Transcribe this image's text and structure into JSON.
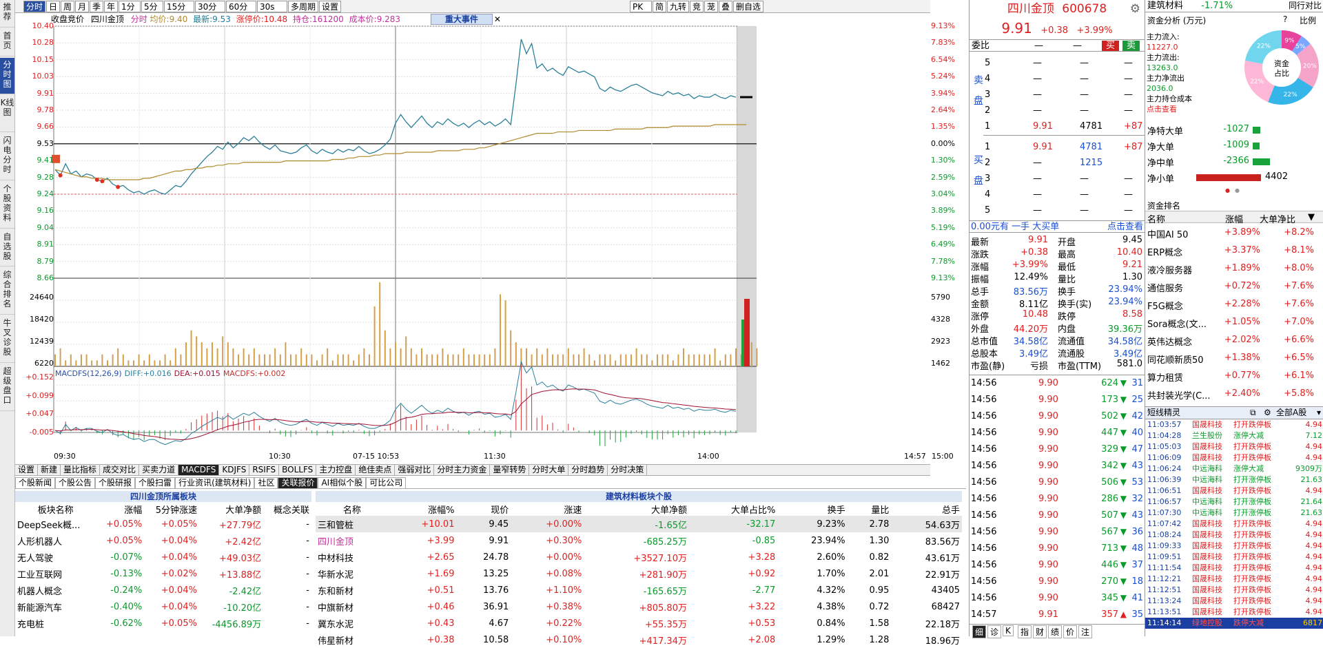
{
  "leftnav": [
    "推荐",
    "首页",
    "分时图",
    "K线图",
    "闪电分时",
    "个股资料",
    "自选股",
    "综合排名",
    "牛叉诊股",
    "超级盘口"
  ],
  "toolbar": {
    "buttons": [
      "分时",
      "日",
      "周",
      "月",
      "季",
      "年",
      "1分",
      "5分",
      "15分",
      "30分",
      "60分",
      "30s",
      "多周期",
      "设置"
    ],
    "right": [
      "PK",
      "简",
      "九转",
      "竞",
      "茏",
      "叠",
      "删自选"
    ]
  },
  "infobar": {
    "mode": "收盘竞价",
    "name": "四川金顶",
    "fenshi": "分时",
    "avg_label": "均价:",
    "avg": "9.40",
    "latest_label": "最新:",
    "latest": "9.53",
    "limit_label": "涨停价:",
    "limit": "10.48",
    "hold_label": "持仓:",
    "hold": "161200",
    "cost_label": "成本价:",
    "cost": "9.283",
    "event": "重大事件"
  },
  "chart_data": {
    "type": "line",
    "title": "",
    "price_axis_left": [
      "10.40",
      "10.28",
      "10.15",
      "10.03",
      "9.91",
      "9.78",
      "9.66",
      "9.53",
      "9.41",
      "9.28",
      "9.24",
      "9.16",
      "9.04",
      "8.91",
      "8.79",
      "8.66"
    ],
    "price_axis_right": [
      "9.13%",
      "7.83%",
      "6.54%",
      "5.24%",
      "3.94%",
      "2.64%",
      "1.35%",
      "0.00%",
      "1.30%",
      "2.59%",
      "3.04%",
      "3.89%",
      "5.19%",
      "6.49%",
      "7.78%",
      "9.13%"
    ],
    "volume_axis_left": [
      "24640",
      "18420",
      "12439",
      "6220"
    ],
    "volume_axis_right": [
      "5790",
      "4328",
      "2923",
      "1462"
    ],
    "macd_axis": [
      "+0.152",
      "+0.099",
      "+0.047",
      "-0.005"
    ],
    "macd_label": "MACDFS(12,26,9)",
    "diff_label": "DIFF:",
    "diff": "+0.016",
    "dea_label": "DEA:",
    "dea": "+0.015",
    "macdfs_label": "MACDFS:",
    "macdfs": "+0.002",
    "time_axis": [
      "09:30",
      "10:30",
      "07-15 10:53",
      "11:30",
      "14:00",
      "14:57",
      "15:00"
    ],
    "prev_close": 9.53,
    "ylim": [
      8.66,
      10.4
    ],
    "price": [
      9.41,
      9.37,
      9.45,
      9.38,
      9.4,
      9.36,
      9.38,
      9.37,
      9.34,
      9.33,
      9.35,
      9.31,
      9.29,
      9.3,
      9.27,
      9.25,
      9.26,
      9.24,
      9.26,
      9.27,
      9.25,
      9.24,
      9.27,
      9.3,
      9.29,
      9.33,
      9.38,
      9.42,
      9.46,
      9.5,
      9.53,
      9.57,
      9.55,
      9.6,
      9.56,
      9.59,
      9.63,
      9.61,
      9.64,
      9.6,
      9.57,
      9.55,
      9.58,
      9.54,
      9.53,
      9.52,
      9.53,
      9.56,
      9.58,
      9.54,
      9.52,
      9.55,
      9.53,
      9.52,
      9.55,
      9.53,
      9.55,
      9.54,
      9.57,
      9.54,
      9.52,
      9.53,
      9.55,
      9.58,
      9.62,
      9.73,
      9.79,
      9.74,
      9.7,
      9.74,
      9.78,
      9.73,
      9.7,
      9.74,
      9.72,
      9.76,
      9.73,
      9.71,
      9.73,
      9.7,
      9.73,
      9.75,
      9.72,
      9.74,
      9.71,
      9.73,
      9.76,
      9.72,
      10.0,
      10.31,
      10.21,
      10.28,
      10.11,
      10.14,
      10.09,
      10.11,
      10.08,
      10.06,
      10.12,
      10.1,
      10.08,
      10.09,
      10.07,
      10.05,
      9.97,
      9.95,
      9.98,
      9.96,
      9.95,
      9.97,
      9.99,
      10.0,
      9.98,
      9.96,
      9.94,
      9.93,
      9.92,
      9.95,
      9.93,
      9.94,
      9.92,
      9.93,
      9.9,
      9.92,
      9.91,
      9.91,
      9.93,
      9.91,
      9.9,
      9.92,
      9.91
    ],
    "avg": [
      9.41,
      9.4,
      9.39,
      9.38,
      9.37,
      9.36,
      9.36,
      9.35,
      9.35,
      9.35,
      9.34,
      9.34,
      9.34,
      9.34,
      9.34,
      9.34,
      9.34,
      9.35,
      9.35,
      9.36,
      9.37,
      9.38,
      9.39,
      9.4,
      9.4,
      9.41,
      9.41,
      9.42,
      9.42,
      9.43,
      9.43,
      9.44,
      9.44,
      9.45,
      9.45,
      9.45,
      9.46,
      9.46,
      9.46,
      9.46,
      9.46,
      9.46,
      9.46,
      9.46,
      9.47,
      9.47,
      9.47,
      9.47,
      9.47,
      9.47,
      9.47,
      9.47,
      9.47,
      9.48,
      9.48,
      9.48,
      9.49,
      9.49,
      9.5,
      9.5,
      9.5,
      9.51,
      9.51,
      9.52,
      9.52,
      9.52,
      9.52,
      9.53,
      9.53,
      9.53,
      9.53,
      9.53,
      9.53,
      9.54,
      9.54,
      9.54,
      9.54,
      9.54,
      9.55,
      9.55,
      9.55,
      9.56,
      9.56,
      9.57,
      9.58,
      9.59,
      9.6,
      9.61,
      9.62,
      9.63,
      9.64,
      9.65,
      9.66,
      9.66,
      9.66,
      9.66,
      9.67,
      9.67,
      9.67,
      9.67,
      9.68,
      9.68,
      9.68,
      9.68,
      9.68,
      9.68,
      9.68,
      9.69,
      9.69,
      9.69,
      9.69,
      9.69,
      9.69,
      9.7,
      9.7,
      9.7,
      9.7,
      9.7,
      9.71,
      9.71,
      9.71,
      9.71,
      9.71,
      9.71,
      9.71,
      9.71,
      9.72,
      9.72,
      9.72,
      9.72,
      9.72,
      9.72,
      9.72
    ],
    "volume": [
      2,
      3,
      1,
      2,
      1,
      2,
      2,
      1,
      1,
      2,
      1,
      2,
      3,
      2,
      1,
      1,
      2,
      1,
      2,
      1,
      1,
      2,
      1,
      3,
      2,
      4,
      6,
      5,
      4,
      3,
      4,
      3,
      5,
      4,
      3,
      2,
      3,
      2,
      3,
      2,
      2,
      2,
      3,
      2,
      4,
      2,
      2,
      3,
      2,
      2,
      1,
      2,
      3,
      1,
      2,
      2,
      2,
      1,
      2,
      3,
      2,
      10,
      14,
      6,
      3,
      4,
      3,
      5,
      3,
      2,
      3,
      2,
      2,
      2,
      3,
      2,
      2,
      2,
      3,
      2,
      2,
      2,
      2,
      2,
      3,
      12,
      11,
      6,
      4,
      3,
      3,
      2,
      3,
      2,
      3,
      2,
      2,
      2,
      3,
      2,
      2,
      3,
      2,
      1,
      2,
      2,
      2,
      1,
      2,
      2,
      2,
      3,
      2,
      2,
      1,
      2,
      2,
      2,
      1,
      2,
      3,
      2,
      2,
      2,
      2,
      2,
      3,
      1,
      2,
      2,
      3,
      2,
      2,
      4,
      3
    ]
  },
  "bottom_tabs": [
    "设置",
    "新建",
    "量比指标",
    "成交对比",
    "买卖力道",
    "MACDFS",
    "KDJFS",
    "RSIFS",
    "BOLLFS",
    "主力控盘",
    "绝佳卖点",
    "强弱对比",
    "分时主力资金",
    "量窄转势",
    "分时大单",
    "分时趋势",
    "分时决策"
  ],
  "bottom_tabs2": [
    "个股新闻",
    "个股公告",
    "个股研报",
    "个股扫雷",
    "行业资讯(建筑材料)",
    "社区",
    "关联报价",
    "AI相似个股",
    "可比公司"
  ],
  "sector_table": {
    "title": "四川金顶所属板块",
    "headers": [
      "板块名称",
      "涨幅",
      "5分钟涨速",
      "大单净额",
      "概念关联"
    ],
    "rows": [
      [
        "DeepSeek概...",
        "+0.05%",
        "+0.05%",
        "+27.79亿",
        "-"
      ],
      [
        "人形机器人",
        "+0.05%",
        "+0.04%",
        "+2.42亿",
        "-"
      ],
      [
        "无人驾驶",
        "-0.07%",
        "+0.04%",
        "+49.03亿",
        "-"
      ],
      [
        "工业互联网",
        "-0.13%",
        "+0.02%",
        "+13.88亿",
        "-"
      ],
      [
        "机器人概念",
        "-0.24%",
        "+0.04%",
        "-2.42亿",
        "-"
      ],
      [
        "新能源汽车",
        "-0.40%",
        "+0.04%",
        "-10.20亿",
        "-"
      ],
      [
        "充电桩",
        "-0.62%",
        "+0.05%",
        "-4456.89万",
        "-"
      ]
    ]
  },
  "stock_table": {
    "title": "建筑材料板块个股",
    "headers": [
      "名称",
      "涨幅%",
      "现价",
      "涨速",
      "大单净额",
      "大单占比%",
      "换手",
      "量比",
      "总手"
    ],
    "rows": [
      [
        "三和管桩",
        "+10.01",
        "9.45",
        "+0.00%",
        "-1.65亿",
        "-32.17",
        "9.23%",
        "2.78",
        "54.63万"
      ],
      [
        "四川金顶",
        "+3.99",
        "9.91",
        "+0.30%",
        "-685.25万",
        "-0.85",
        "23.94%",
        "1.30",
        "83.56万"
      ],
      [
        "中材科技",
        "+2.65",
        "24.78",
        "+0.00%",
        "+3527.10万",
        "+3.28",
        "2.60%",
        "0.82",
        "43.61万"
      ],
      [
        "华新水泥",
        "+1.69",
        "13.25",
        "+0.08%",
        "+281.90万",
        "+0.92",
        "1.70%",
        "2.01",
        "22.91万"
      ],
      [
        "东和新材",
        "+0.51",
        "13.76",
        "+1.10%",
        "-165.65万",
        "-2.77",
        "4.32%",
        "0.95",
        "43405"
      ],
      [
        "中旗新材",
        "+0.46",
        "36.91",
        "+0.38%",
        "+805.80万",
        "+3.22",
        "4.38%",
        "0.72",
        "68427"
      ],
      [
        "冀东水泥",
        "+0.43",
        "4.67",
        "+0.22%",
        "+55.35万",
        "+0.53",
        "0.84%",
        "1.58",
        "22.18万"
      ],
      [
        "伟星新材",
        "+0.38",
        "10.58",
        "+0.10%",
        "+417.34万",
        "+2.08",
        "1.29%",
        "1.28",
        "18.96万"
      ]
    ]
  },
  "quote": {
    "name": "四川金顶",
    "code": "600678",
    "price": "9.91",
    "change": "+0.38",
    "pct": "+3.99%",
    "weibi": "委比",
    "buy": "买",
    "sell": "卖",
    "sell_label": "卖盘",
    "buy_label": "买盘",
    "asks": [
      [
        "5",
        "—",
        "—",
        "—"
      ],
      [
        "4",
        "—",
        "—",
        "—"
      ],
      [
        "3",
        "—",
        "—",
        "—"
      ],
      [
        "2",
        "—",
        "—",
        "—"
      ],
      [
        "1",
        "9.91",
        "4781",
        "+87"
      ]
    ],
    "bids": [
      [
        "1",
        "9.91",
        "4781",
        "+87"
      ],
      [
        "2",
        "—",
        "1215",
        ""
      ],
      [
        "3",
        "—",
        "—",
        "—"
      ],
      [
        "4",
        "—",
        "—",
        "—"
      ],
      [
        "5",
        "—",
        "—",
        "—"
      ]
    ],
    "dadan": {
      "a": "0.00元有",
      "b": "一手",
      "c": "大买单",
      "d": "点击查看"
    },
    "stats": [
      [
        "最新",
        "9.91",
        "开盘",
        "9.45"
      ],
      [
        "涨跌",
        "+0.38",
        "最高",
        "10.40"
      ],
      [
        "涨幅",
        "+3.99%",
        "最低",
        "9.21"
      ],
      [
        "振幅",
        "12.49%",
        "量比",
        "1.30"
      ],
      [
        "总手",
        "83.56万",
        "换手",
        "23.94%"
      ],
      [
        "金额",
        "8.11亿",
        "换手(实)",
        "23.94%"
      ],
      [
        "涨停",
        "10.48",
        "跌停",
        "8.58"
      ],
      [
        "外盘",
        "44.20万",
        "内盘",
        "39.36万"
      ],
      [
        "总市值",
        "34.58亿",
        "流通值",
        "34.58亿"
      ],
      [
        "总股本",
        "3.49亿",
        "流通股",
        "3.49亿"
      ],
      [
        "市盈(静)",
        "亏损",
        "市盈(TTM)",
        "581.0"
      ]
    ],
    "ticks": [
      [
        "14:56",
        "9.90",
        "624",
        "31"
      ],
      [
        "14:56",
        "9.90",
        "173",
        "25"
      ],
      [
        "14:56",
        "9.90",
        "502",
        "42"
      ],
      [
        "14:56",
        "9.90",
        "447",
        "40"
      ],
      [
        "14:56",
        "9.90",
        "329",
        "47"
      ],
      [
        "14:56",
        "9.90",
        "342",
        "43"
      ],
      [
        "14:56",
        "9.90",
        "506",
        "53"
      ],
      [
        "14:56",
        "9.90",
        "286",
        "32"
      ],
      [
        "14:56",
        "9.90",
        "507",
        "43"
      ],
      [
        "14:56",
        "9.90",
        "567",
        "36"
      ],
      [
        "14:56",
        "9.90",
        "713",
        "48"
      ],
      [
        "14:56",
        "9.90",
        "446",
        "37"
      ],
      [
        "14:56",
        "9.90",
        "270",
        "18"
      ],
      [
        "14:56",
        "9.90",
        "345",
        "41"
      ],
      [
        "14:57",
        "9.91",
        "357",
        "35"
      ]
    ],
    "bottom": [
      "细",
      "诊",
      "K",
      "指",
      "财",
      "绩",
      "价",
      "注"
    ]
  },
  "right": {
    "sector": "建筑材料",
    "sector_pct": "-1.71%",
    "sector_tag": "同行对比",
    "fund": "资金分析 (万元)",
    "help": "?",
    "ratio": "比例",
    "inflow_label": "主力流入:",
    "inflow": "11227.0",
    "outflow_label": "主力流出:",
    "outflow": "13263.0",
    "net_label": "主力净流出",
    "net": "2036.0",
    "cost_label": "主力持仓成本",
    "cost": "点击查看",
    "donut_center": "资金占比",
    "donut": [
      [
        "9%",
        0.09,
        "#e8439a"
      ],
      [
        "5%",
        0.05,
        "#7aa7ff"
      ],
      [
        "20%",
        0.2,
        "#f4a3c9"
      ],
      [
        "22%",
        0.22,
        "#36b5e8"
      ],
      [
        "22%",
        0.22,
        "#ffb7d7"
      ],
      [
        "22%",
        0.22,
        "#6fd6ee"
      ]
    ],
    "flows": [
      [
        "净特大单",
        "-1027",
        0.18,
        "#1aa33a"
      ],
      [
        "净大单",
        "-1009",
        0.17,
        "#1aa33a"
      ],
      [
        "净中单",
        "-2366",
        0.42,
        "#1aa33a"
      ],
      [
        "净小单",
        "4402",
        0.78,
        "#c9211e"
      ]
    ],
    "rank_title": "资金排名",
    "rank_headers": [
      "名称",
      "涨幅",
      "大单净比"
    ],
    "rank": [
      [
        "中国AI 50",
        "+3.89%",
        "+8.2%"
      ],
      [
        "ERP概念",
        "+3.37%",
        "+8.1%"
      ],
      [
        "液冷服务器",
        "+1.89%",
        "+8.0%"
      ],
      [
        "通信服务",
        "+0.72%",
        "+7.6%"
      ],
      [
        "F5G概念",
        "+2.28%",
        "+7.6%"
      ],
      [
        "Sora概念(文...",
        "+1.05%",
        "+7.0%"
      ],
      [
        "英伟达概念",
        "+2.02%",
        "+6.6%"
      ],
      [
        "同花顺新质50",
        "+1.38%",
        "+6.5%"
      ],
      [
        "算力租赁",
        "+0.77%",
        "+6.1%"
      ],
      [
        "共封装光学(C...",
        "+2.40%",
        "+5.8%"
      ]
    ],
    "short_title": "短线精灵",
    "short_all": "全部A股",
    "short": [
      [
        "11:03:57",
        "国晟科技",
        "打开跌停板",
        "4.94",
        "r"
      ],
      [
        "11:04:28",
        "兰生股份",
        "涨停大减",
        "7.12",
        "g"
      ],
      [
        "11:05:03",
        "国晟科技",
        "打开跌停板",
        "4.94",
        "r"
      ],
      [
        "11:06:09",
        "国晟科技",
        "打开跌停板",
        "4.94",
        "r"
      ],
      [
        "11:06:24",
        "中远海科",
        "涨停大减",
        "9309万",
        "g"
      ],
      [
        "11:06:39",
        "中远海科",
        "打开涨停板",
        "21.63",
        "g"
      ],
      [
        "11:06:51",
        "国晟科技",
        "打开跌停板",
        "4.94",
        "r"
      ],
      [
        "11:06:57",
        "中远海科",
        "打开涨停板",
        "21.64",
        "g"
      ],
      [
        "11:07:30",
        "中远海科",
        "打开涨停板",
        "21.63",
        "g"
      ],
      [
        "11:07:42",
        "国晟科技",
        "打开跌停板",
        "4.94",
        "r"
      ],
      [
        "11:08:24",
        "国晟科技",
        "打开跌停板",
        "4.94",
        "r"
      ],
      [
        "11:09:33",
        "国晟科技",
        "打开跌停板",
        "4.94",
        "r"
      ],
      [
        "11:09:51",
        "国晟科技",
        "打开跌停板",
        "4.94",
        "r"
      ],
      [
        "11:11:54",
        "国晟科技",
        "打开跌停板",
        "4.94",
        "r"
      ],
      [
        "11:12:21",
        "国晟科技",
        "打开跌停板",
        "4.94",
        "r"
      ],
      [
        "11:12:51",
        "国晟科技",
        "打开跌停板",
        "4.94",
        "r"
      ],
      [
        "11:13:24",
        "国晟科技",
        "打开跌停板",
        "4.94",
        "r"
      ],
      [
        "11:13:51",
        "国晟科技",
        "打开跌停板",
        "4.94",
        "r"
      ],
      [
        "11:14:14",
        "绿地控股",
        "跌停大减",
        "6817",
        "r"
      ]
    ]
  }
}
